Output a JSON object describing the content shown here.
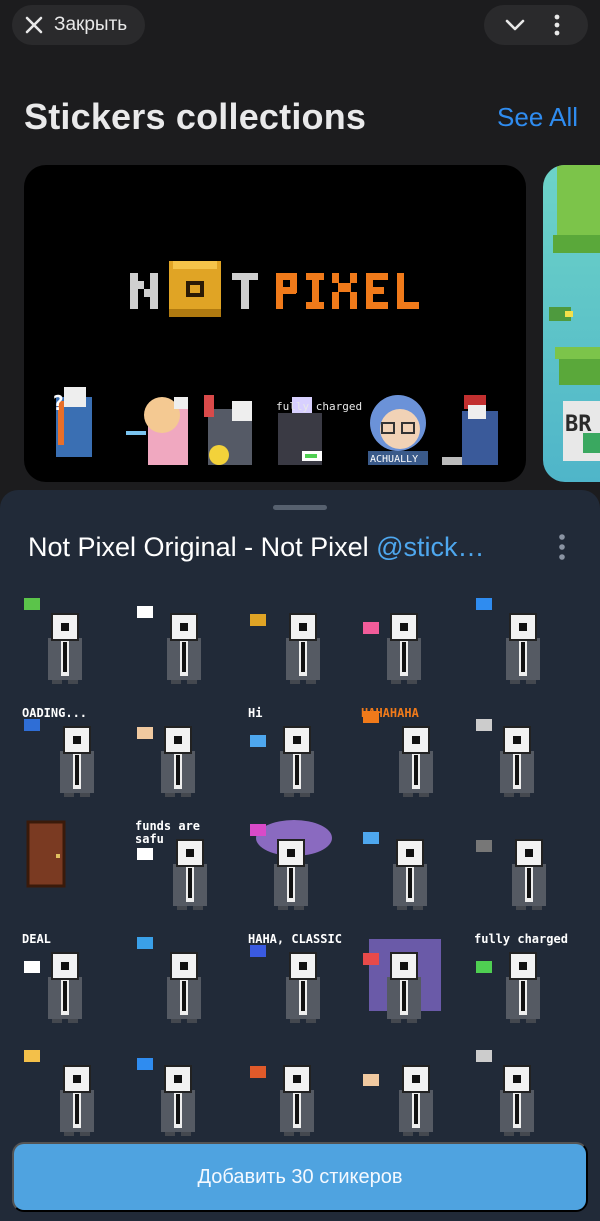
{
  "topbar": {
    "close_label": "Закрыть",
    "close_icon": "close-icon",
    "chevron_icon": "chevron-down-icon",
    "more_icon": "more-vertical-icon"
  },
  "collections": {
    "title": "Stickers collections",
    "see_all": "See All",
    "banner": {
      "logo_left": "N T",
      "logo_right": "PIXEL",
      "sticker_captions": [
        "fully charged",
        "ACHUALLY"
      ]
    }
  },
  "sheet": {
    "title": "Not Pixel Original - Not Pixel ",
    "title_link": "@stick…",
    "stickers": [
      {
        "name": "money-sticker"
      },
      {
        "name": "sparkle-sticker"
      },
      {
        "name": "pixel-box-sticker"
      },
      {
        "name": "hearts-sticker"
      },
      {
        "name": "computer-sticker"
      },
      {
        "name": "loading-sticker",
        "caption": "OADING..."
      },
      {
        "name": "pointing-sticker"
      },
      {
        "name": "hi-sticker",
        "caption": "Hi"
      },
      {
        "name": "hahaha-sticker",
        "caption": "HAHAHAHA"
      },
      {
        "name": "thinking-sticker"
      },
      {
        "name": "door-sticker"
      },
      {
        "name": "funds-sticker",
        "caption": "funds are safu"
      },
      {
        "name": "dream-sticker"
      },
      {
        "name": "thumbs-down-sticker"
      },
      {
        "name": "closeup-sticker"
      },
      {
        "name": "deal-sticker",
        "caption": "DEAL"
      },
      {
        "name": "crying-sticker"
      },
      {
        "name": "haha-classic-sticker",
        "caption": "HAHA, CLASSIC"
      },
      {
        "name": "noise-sticker"
      },
      {
        "name": "fully-charged-sticker",
        "caption": "fully charged"
      },
      {
        "name": "cat-sticker"
      },
      {
        "name": "question-sticker"
      },
      {
        "name": "camera-sticker"
      },
      {
        "name": "shrug-sticker"
      },
      {
        "name": "standing-sticker"
      }
    ],
    "add_button": "Добавить 30 стикеров"
  },
  "colors": {
    "accent": "#2f8cf0",
    "sheet_bg": "#212a38",
    "button_bg": "#4fa3e0"
  }
}
